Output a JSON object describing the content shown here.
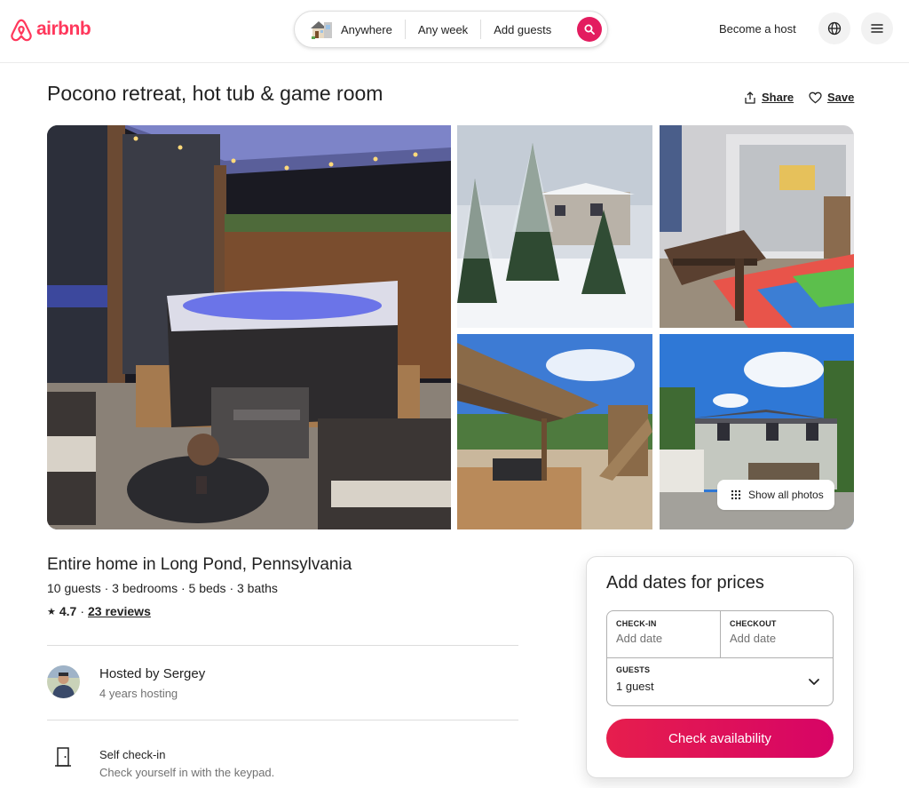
{
  "header": {
    "logo_text": "airbnb",
    "search": {
      "anywhere": "Anywhere",
      "any_week": "Any week",
      "add_guests": "Add guests"
    },
    "become_host": "Become a host",
    "brand_color": "#ff385c",
    "search_button_color": "#e31c5f"
  },
  "listing": {
    "title": "Pocono retreat, hot tub & game room",
    "share_label": "Share",
    "save_label": "Save",
    "show_all_photos": "Show all photos",
    "home_type": "Entire home in Long Pond, Pennsylvania",
    "meta": "10 guests · 3 bedrooms · 5 beds · 3 baths",
    "rating_star": "★",
    "rating": "4.7",
    "rating_sep": "·",
    "reviews": "23 reviews",
    "host": {
      "name": "Hosted by Sergey",
      "years": "4 years hosting"
    },
    "feature": {
      "title": "Self check-in",
      "description": "Check yourself in with the keypad."
    }
  },
  "booking": {
    "title": "Add dates for prices",
    "checkin_label": "CHECK-IN",
    "checkin_value": "Add date",
    "checkout_label": "CHECKOUT",
    "checkout_value": "Add date",
    "guests_label": "GUESTS",
    "guests_value": "1 guest",
    "cta": "Check availability",
    "cta_colors": [
      "#e61e4d",
      "#d70466"
    ]
  },
  "icons": [
    "airbnb-logo-icon",
    "house-icon",
    "search-icon",
    "globe-icon",
    "menu-icon",
    "share-icon",
    "heart-icon",
    "grid-icon",
    "door-icon",
    "chevron-down-icon"
  ]
}
